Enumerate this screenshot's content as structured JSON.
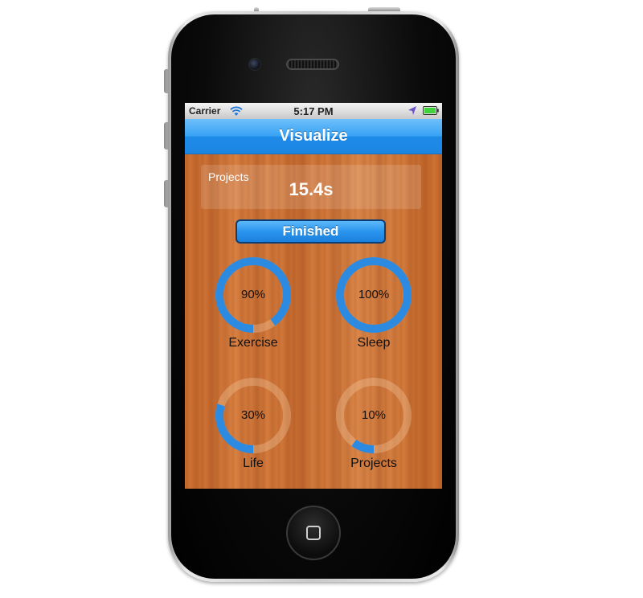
{
  "status_bar": {
    "carrier": "Carrier",
    "time": "5:17 PM"
  },
  "nav": {
    "title": "Visualize"
  },
  "timer": {
    "label": "Projects",
    "value": "15.4s"
  },
  "finished_button": {
    "label": "Finished"
  },
  "rings": [
    {
      "label": "Exercise",
      "percent_text": "90%",
      "progress": 0.9
    },
    {
      "label": "Sleep",
      "percent_text": "100%",
      "progress": 1.0
    },
    {
      "label": "Life",
      "percent_text": "30%",
      "progress": 0.3
    },
    {
      "label": "Projects",
      "percent_text": "10%",
      "progress": 0.1
    }
  ],
  "colors": {
    "accent": "#2c8ae0",
    "nav_top": "#6ec0fb",
    "nav_bottom": "#1d86e2",
    "wood": "#cf733a"
  }
}
